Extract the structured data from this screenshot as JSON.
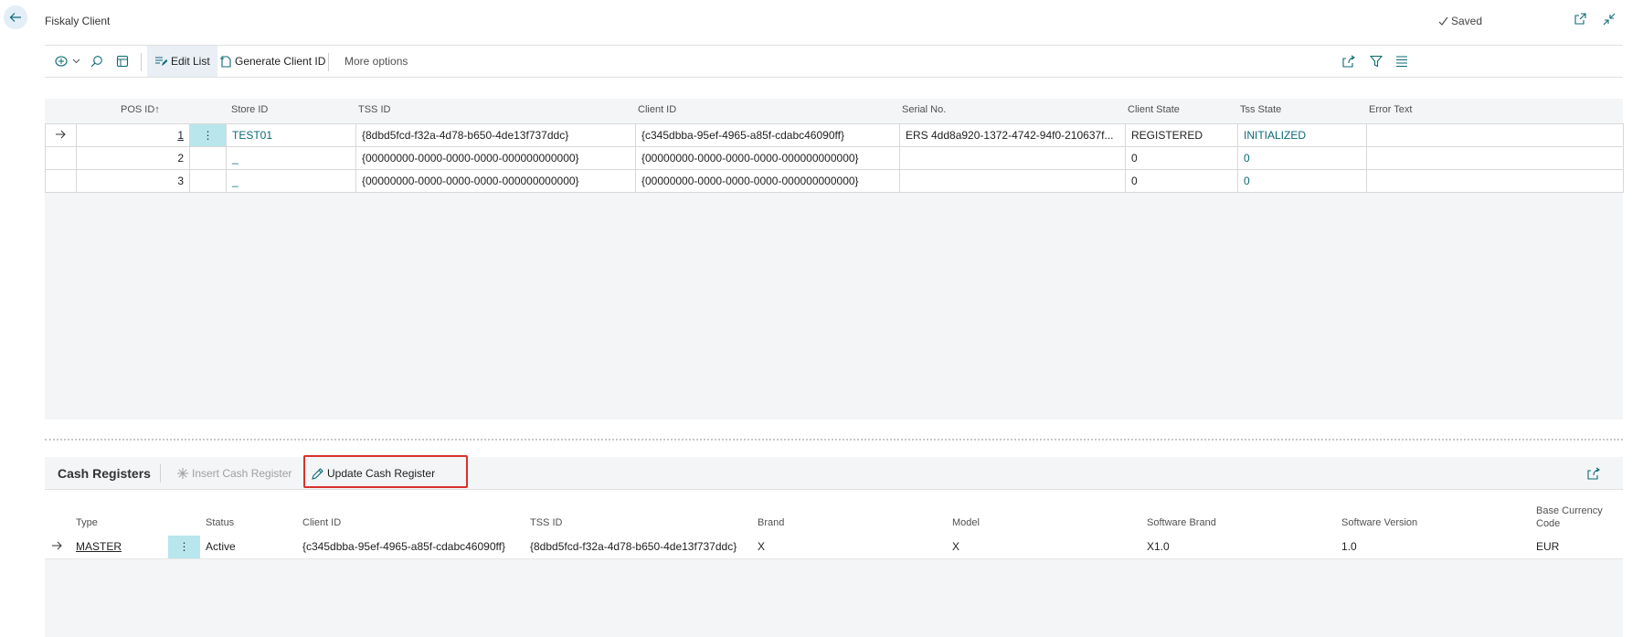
{
  "header": {
    "title": "Fiskaly Client",
    "saved_label": "Saved"
  },
  "actionbar": {
    "edit_list": "Edit List",
    "generate_client_id": "Generate Client ID",
    "more_options": "More options"
  },
  "main_list": {
    "columns": {
      "pos_id": "POS ID",
      "sort_indicator": "↑",
      "store_id": "Store ID",
      "tss_id": "TSS ID",
      "client_id": "Client ID",
      "serial_no": "Serial No.",
      "client_state": "Client State",
      "tss_state": "Tss State",
      "error_text": "Error Text"
    },
    "rows": [
      {
        "pos_id": "1",
        "store_id": "TEST01",
        "tss_id": "{8dbd5fcd-f32a-4d78-b650-4de13f737ddc}",
        "client_id": "{c345dbba-95ef-4965-a85f-cdabc46090ff}",
        "serial_no": "ERS 4dd8a920-1372-4742-94f0-210637f...",
        "client_state": "REGISTERED",
        "tss_state": "INITIALIZED",
        "error_text": ""
      },
      {
        "pos_id": "2",
        "store_id": "_",
        "tss_id": "{00000000-0000-0000-0000-000000000000}",
        "client_id": "{00000000-0000-0000-0000-000000000000}",
        "serial_no": "",
        "client_state": "0",
        "tss_state": "0",
        "error_text": ""
      },
      {
        "pos_id": "3",
        "store_id": "_",
        "tss_id": "{00000000-0000-0000-0000-000000000000}",
        "client_id": "{00000000-0000-0000-0000-000000000000}",
        "serial_no": "",
        "client_state": "0",
        "tss_state": "0",
        "error_text": ""
      }
    ]
  },
  "subpage": {
    "title": "Cash Registers",
    "insert_label": "Insert Cash Register",
    "update_label": "Update Cash Register",
    "columns": {
      "type": "Type",
      "status": "Status",
      "client_id": "Client ID",
      "tss_id": "TSS ID",
      "brand": "Brand",
      "model": "Model",
      "software_brand": "Software Brand",
      "software_version": "Software Version",
      "base_currency_line1": "Base Currency",
      "base_currency_line2": "Code"
    },
    "rows": [
      {
        "type": "MASTER",
        "status": "Active",
        "client_id": "{c345dbba-95ef-4965-a85f-cdabc46090ff}",
        "tss_id": "{8dbd5fcd-f32a-4d78-b650-4de13f737ddc}",
        "brand": "X",
        "model": "X",
        "software_brand": "X1.0",
        "software_version": "1.0",
        "base_currency_code": "EUR"
      }
    ]
  },
  "colors": {
    "accent": "#0b6a75",
    "highlight_border": "#d9312b",
    "selected_cell": "#b8e6ec"
  }
}
